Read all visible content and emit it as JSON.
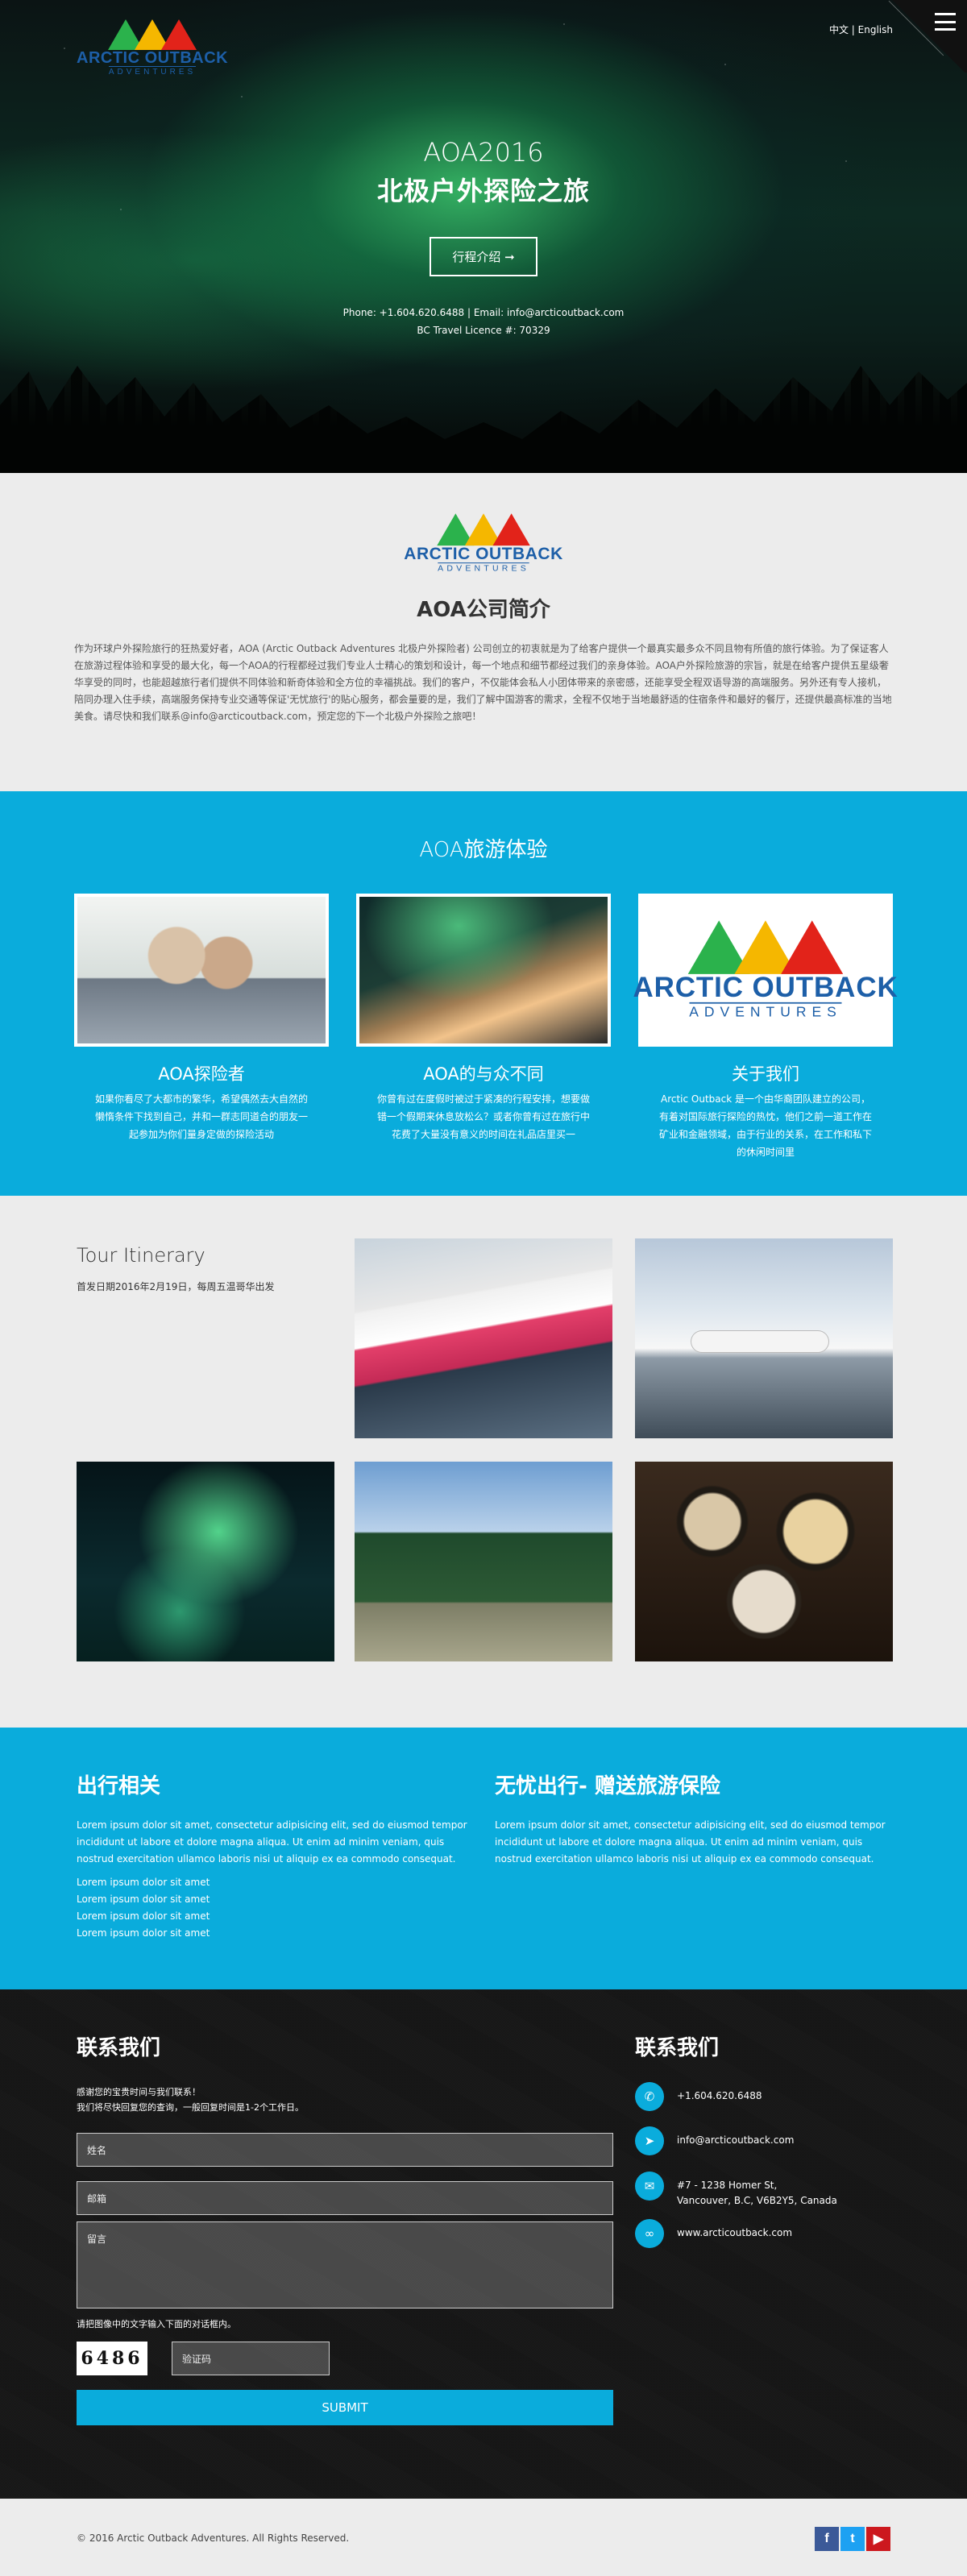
{
  "brand": {
    "name": "ARCTIC OUTBACK",
    "sub": "ADVENTURES"
  },
  "header": {
    "lang_cn": "中文",
    "lang_sep": "|",
    "lang_en": "English"
  },
  "hero": {
    "title": "AOA2016",
    "subtitle": "北极户外探险之旅",
    "button": "行程介绍 ➞",
    "contact_line1": "Phone: +1.604.620.6488  |  Email: info@arcticoutback.com",
    "contact_line2": "BC Travel Licence #: 70329",
    "up_icon": "↑"
  },
  "about": {
    "title_a": "AOA",
    "title_b": "公司简介",
    "text": "作为环球户外探险旅行的狂热爱好者，AOA (Arctic Outback Adventures 北极户外探险者) 公司创立的初衷就是为了给客户提供一个最真实最多众不同且物有所值的旅行体验。为了保证客人在旅游过程体验和享受的最大化，每一个AOA的行程都经过我们专业人士精心的策划和设计，每一个地点和细节都经过我们的亲身体验。AOA户外探险旅游的宗旨，就是在给客户提供五星级奢华享受的同时，也能超越旅行者们提供不同体验和新奇体验和全方位的幸福挑战。我们的客户，不仅能体会私人小团体带来的亲密感，还能享受全程双语导游的高端服务。另外还有专人接机，陪同办理入住手续，高端服务保持专业交通等保证'无忧旅行'的贴心服务，都会量要的是，我们了解中国游客的需求，全程不仅地于当地最舒适的住宿条件和最好的餐厅，还提供最高标准的当地美食。请尽快和我们联系@info@arcticoutback.com，预定您的下一个北极户外探险之旅吧！"
  },
  "experience": {
    "title_a": "AOA",
    "title_b": "旅游体验",
    "cards": [
      {
        "title": "AOA探险者",
        "text": "如果你看尽了大都市的繁华，希望偶然去大自然的懒惰条件下找到自己，并和一群志同道合的朋友一起参加为你们量身定做的探险活动"
      },
      {
        "title": "AOA的与众不同",
        "text": "你曾有过在度假时被过于紧凑的行程安排，想要做错一个假期来休息放松么？或者你曾有过在旅行中花费了大量没有意义的时间在礼品店里买一"
      },
      {
        "title": "关于我们",
        "text": "Arctic Outback 是一个由华裔团队建立的公司，有着对国际旅行探险的热忱，他们之前一道工作在矿业和金融领域，由于行业的关系，在工作和私下的休闲时间里"
      }
    ]
  },
  "itinerary": {
    "title": "Tour Itinerary",
    "note": "首发日期2016年2月19日，每周五温哥华出发"
  },
  "info": {
    "left_title": "出行相关",
    "left_text": "Lorem ipsum dolor sit amet, consectetur adipisicing elit, sed do eiusmod tempor incididunt ut labore et dolore magna aliqua. Ut enim ad minim veniam, quis nostrud exercitation ullamco laboris nisi ut aliquip ex ea commodo consequat.",
    "list": [
      "Lorem ipsum dolor sit amet",
      "Lorem ipsum dolor sit amet",
      "Lorem ipsum dolor sit amet",
      "Lorem ipsum dolor sit amet"
    ],
    "right_title": "无忧出行- 赠送旅游保险",
    "right_text": "Lorem ipsum dolor sit amet, consectetur adipisicing elit, sed do eiusmod tempor incididunt ut labore et dolore magna aliqua. Ut enim ad minim veniam, quis nostrud exercitation ullamco laboris nisi ut aliquip ex ea commodo consequat."
  },
  "contact": {
    "form_title": "联系我们",
    "intro1": "感谢您的宝贵时间与我们联系！",
    "intro2": "我们将尽快回复您的查询，一般回复时间是1-2个工作日。",
    "name_ph": "姓名",
    "email_ph": "邮箱",
    "message_ph": "留言",
    "captcha_label": "请把图像中的文字输入下面的对话框内。",
    "captcha_code": "6486",
    "captcha_ph": "验证码",
    "submit": "SUBMIT",
    "info_title": "联系我们",
    "phone": "+1.604.620.6488",
    "email": "info@arcticoutback.com",
    "addr1": "#7 - 1238 Homer St,",
    "addr2": "Vancouver, B.C, V6B2Y5, Canada",
    "web": "www.arcticoutback.com"
  },
  "footer": {
    "copyright": "© 2016 Arctic Outback Adventures. All Rights Reserved.",
    "fb": "f",
    "tw": "t",
    "yt": "▶"
  }
}
